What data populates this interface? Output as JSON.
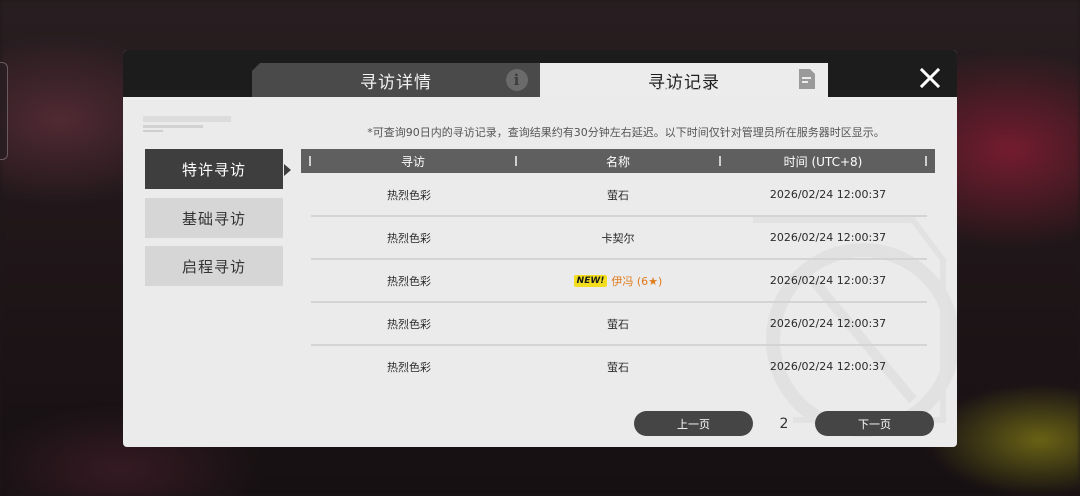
{
  "tabs": {
    "details": {
      "label": "寻访详情",
      "icon": "info-icon"
    },
    "records": {
      "label": "寻访记录",
      "icon": "document-icon",
      "active": true
    }
  },
  "close": {
    "icon": "close-icon"
  },
  "sidebar": {
    "items": [
      {
        "label": "特许寻访",
        "active": true
      },
      {
        "label": "基础寻访",
        "active": false
      },
      {
        "label": "启程寻访",
        "active": false
      }
    ]
  },
  "notice": "*可查询90日内的寻访记录，查询结果约有30分钟左右延迟。以下时间仅针对管理员所在服务器时区显示。",
  "table": {
    "headers": [
      "寻访",
      "名称",
      "时间 (UTC+8)"
    ],
    "rows": [
      {
        "banner": "热烈色彩",
        "name": "萤石",
        "time": "2026/02/24 12:00:37",
        "is_new": false,
        "badge": ""
      },
      {
        "banner": "热烈色彩",
        "name": "卡契尔",
        "time": "2026/02/24 12:00:37",
        "is_new": false,
        "badge": ""
      },
      {
        "banner": "热烈色彩",
        "name": "伊冯 (6★)",
        "time": "2026/02/24 12:00:37",
        "is_new": true,
        "badge": "NEW!"
      },
      {
        "banner": "热烈色彩",
        "name": "萤石",
        "time": "2026/02/24 12:00:37",
        "is_new": false,
        "badge": ""
      },
      {
        "banner": "热烈色彩",
        "name": "萤石",
        "time": "2026/02/24 12:00:37",
        "is_new": false,
        "badge": ""
      }
    ]
  },
  "pager": {
    "prev_label": "上一页",
    "next_label": "下一页",
    "page": "2"
  },
  "colors": {
    "accent_new": "#f2de1e",
    "highlight_text": "#e07b1c",
    "active_side": "#3e3e3e"
  }
}
